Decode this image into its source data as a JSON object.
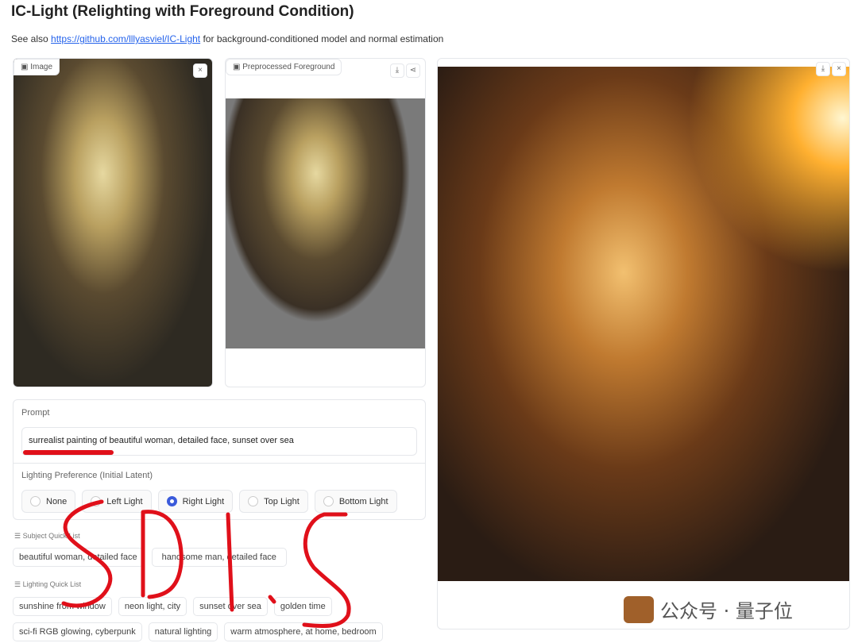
{
  "title": "IC-Light (Relighting with Foreground Condition)",
  "subtitle": {
    "prefix": "See also ",
    "link": "https://github.com/lllyasviel/IC-Light",
    "suffix": " for background-conditioned model and normal estimation"
  },
  "image_input": {
    "label": "Image",
    "close": "×"
  },
  "preprocessed": {
    "label": "Preprocessed Foreground",
    "download": "⤓",
    "share": "⋖"
  },
  "output": {
    "download": "⤓",
    "close": "×"
  },
  "prompt": {
    "label": "Prompt",
    "value": "surrealist painting of beautiful woman, detailed face, sunset over sea"
  },
  "lighting": {
    "label": "Lighting Preference (Initial Latent)",
    "options": [
      "None",
      "Left Light",
      "Right Light",
      "Top Light",
      "Bottom Light"
    ],
    "selected": "Right Light"
  },
  "subject_quick_list": {
    "label": "Subject Quick List",
    "items": [
      "beautiful woman, detailed face",
      "handsome man, detailed face"
    ]
  },
  "lighting_quick_list": {
    "label": "Lighting Quick List",
    "items": [
      "sunshine from window",
      "neon light, city",
      "sunset over sea",
      "golden time",
      "sci-fi RGB glowing, cyberpunk",
      "natural lighting",
      "warm atmosphere, at home, bedroom"
    ]
  },
  "annotation": "SDI.S",
  "watermark": {
    "text": "公众号 · 量子位"
  },
  "colors": {
    "accent": "#3b5bdb",
    "annotation": "#e0101a",
    "link": "#2563eb"
  }
}
